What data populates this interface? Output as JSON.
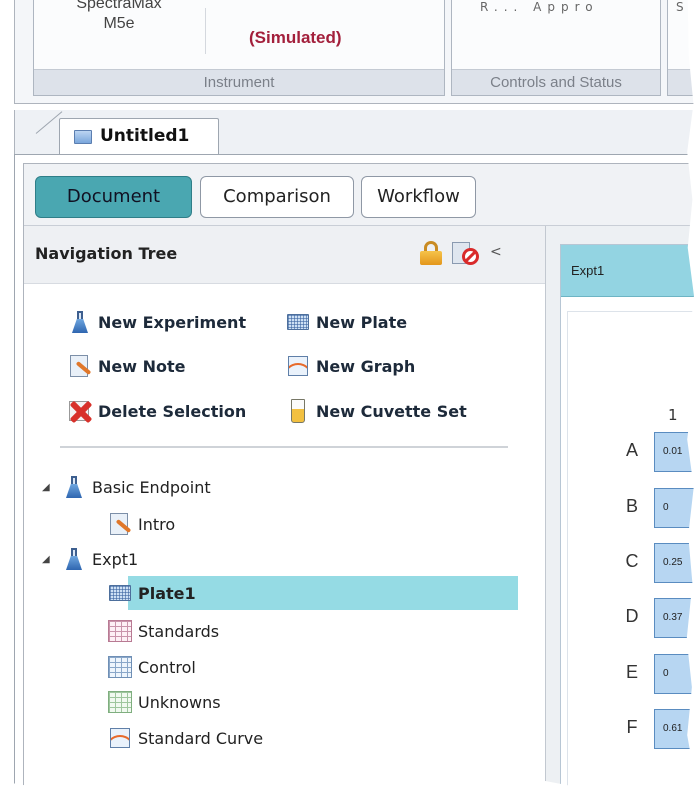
{
  "ribbon": {
    "instrument": {
      "name_line1": "SpectraMax",
      "name_line2": "M5e",
      "status": "(Simulated)",
      "group_label": "Instrument"
    },
    "controls": {
      "faded_text": "R... Appro",
      "group_label": "Controls and Status"
    },
    "extra": {
      "faded_text": "S"
    }
  },
  "document_tab": {
    "label": "Untitled1"
  },
  "mode_buttons": {
    "document": "Document",
    "comparison": "Comparison",
    "workflow": "Workflow"
  },
  "navigation_tree": {
    "title": "Navigation Tree",
    "collapse_glyph": "<",
    "actions": {
      "new_experiment": "New Experiment",
      "new_plate": "New Plate",
      "new_note": "New Note",
      "new_graph": "New Graph",
      "delete_selection": "Delete Selection",
      "new_cuvette_set": "New Cuvette Set"
    },
    "tree": {
      "basic_endpoint": "Basic Endpoint",
      "intro": "Intro",
      "expt1": "Expt1",
      "plate1": "Plate1",
      "standards": "Standards",
      "control": "Control",
      "unknowns": "Unknowns",
      "standard_curve": "Standard Curve"
    },
    "expander_glyph": "◢"
  },
  "experiment_view": {
    "title": "Expt1",
    "column_label": "1",
    "rows": [
      {
        "label": "A",
        "value": "0.01"
      },
      {
        "label": "B",
        "value": "0"
      },
      {
        "label": "C",
        "value": "0.25"
      },
      {
        "label": "D",
        "value": "0.37"
      },
      {
        "label": "E",
        "value": "0"
      },
      {
        "label": "F",
        "value": "0.61"
      }
    ]
  }
}
